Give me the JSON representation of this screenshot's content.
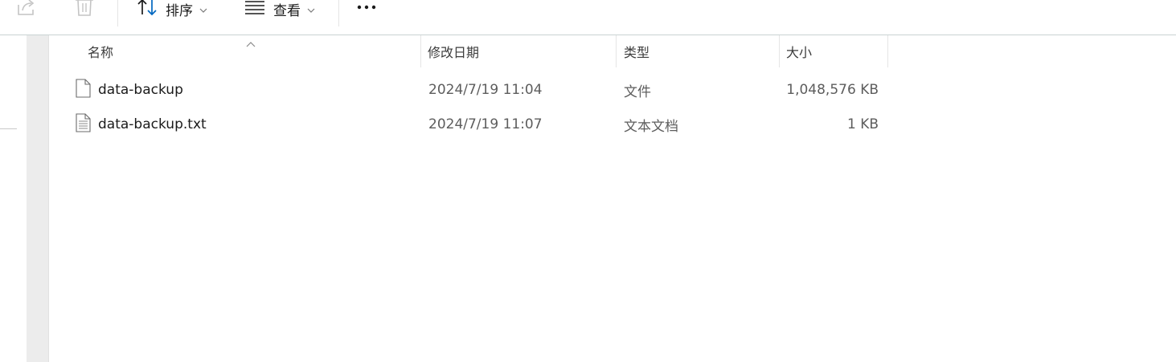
{
  "toolbar": {
    "share_icon": "share-icon",
    "delete_icon": "trash-icon",
    "sort": {
      "icon": "sort-icon",
      "label": "排序"
    },
    "view": {
      "icon": "view-lines-icon",
      "label": "查看"
    },
    "more": {
      "icon": "more-icon",
      "label": "•••"
    }
  },
  "columns": {
    "name": "名称",
    "modified": "修改日期",
    "type": "类型",
    "size": "大小"
  },
  "files": [
    {
      "name": "data-backup",
      "modified": "2024/7/19 11:04",
      "type": "文件",
      "size": "1,048,576 KB",
      "icon": "blank-file-icon"
    },
    {
      "name": "data-backup.txt",
      "modified": "2024/7/19 11:07",
      "type": "文本文档",
      "size": "1 KB",
      "icon": "text-file-icon"
    }
  ],
  "colors": {
    "accent": "#0067c0",
    "toolbar_border": "#c9d3d2",
    "gutter": "#ececec"
  }
}
